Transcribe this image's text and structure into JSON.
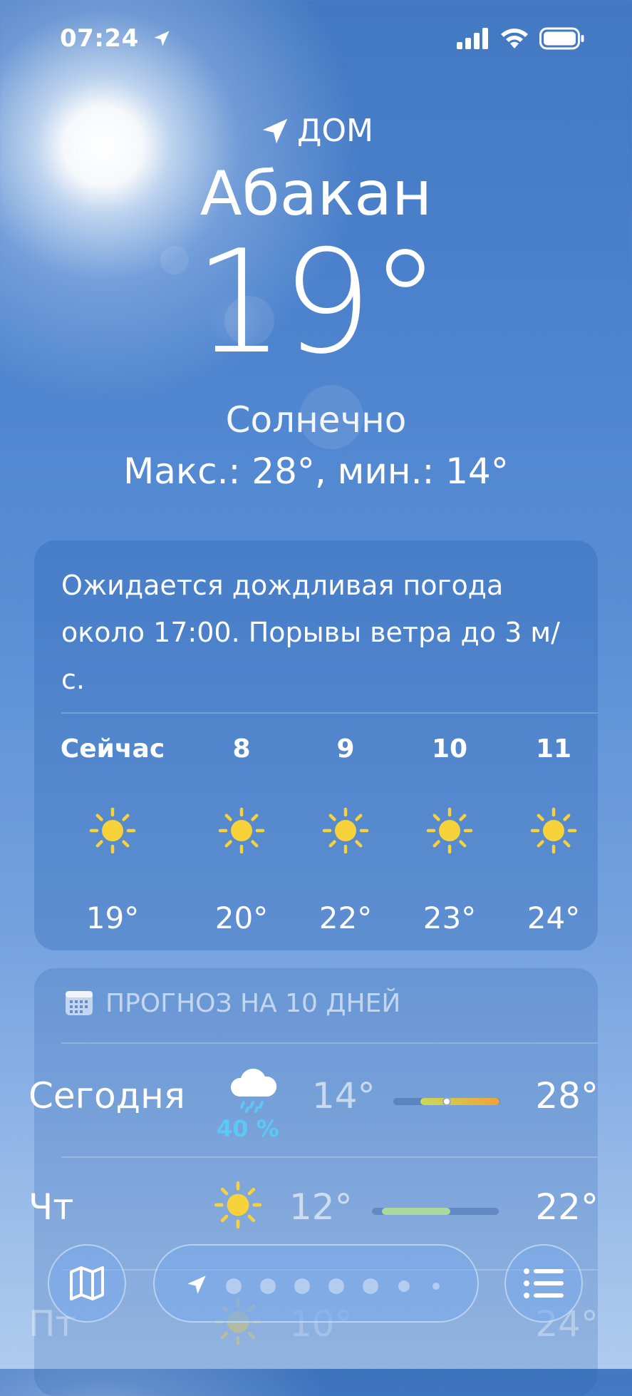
{
  "status_bar": {
    "time": "07:24",
    "icons": [
      "location-arrow-icon",
      "cellular-signal-icon",
      "wifi-icon",
      "battery-icon"
    ]
  },
  "location": {
    "label": "ДОМ",
    "city": "Абакан",
    "temperature": "19°",
    "condition": "Солнечно",
    "high_low": "Макс.: 28°, мин.: 14°"
  },
  "hourly": {
    "summary": "Ожидается дождливая погода около 17:00. Порывы ветра до 3 м/с.",
    "hours": [
      {
        "label": "Сейчас",
        "icon": "sun-icon",
        "temp": "19°"
      },
      {
        "label": "8",
        "icon": "sun-icon",
        "temp": "20°"
      },
      {
        "label": "9",
        "icon": "sun-icon",
        "temp": "22°"
      },
      {
        "label": "10",
        "icon": "sun-icon",
        "temp": "23°"
      },
      {
        "label": "11",
        "icon": "sun-icon",
        "temp": "24°"
      }
    ]
  },
  "forecast": {
    "title": "ПРОГНОЗ НА 10 ДНЕЙ",
    "days": [
      {
        "name": "Сегодня",
        "icon": "rain-cloud-icon",
        "precip": "40 %",
        "low": "14°",
        "high": "28°",
        "range_start": 0.25,
        "range_end": 0.99,
        "current": 0.5
      },
      {
        "name": "Чт",
        "icon": "sun-icon",
        "low": "12°",
        "high": "22°",
        "range_start": 0.08,
        "range_end": 0.62
      },
      {
        "name": "Пт",
        "icon": "sun-icon",
        "low": "10°",
        "high": "24°"
      }
    ]
  },
  "toolbar": {
    "map_button": "map-icon",
    "list_button": "list-icon",
    "page_indicator": {
      "current_location": "location-arrow-icon",
      "page_count": 7
    }
  },
  "colors": {
    "sun": "#f7d23a",
    "precip": "#5cc8f5",
    "bar_today_start": "#c9d95a",
    "bar_today_end": "#f0a33a",
    "bar_cool": "#a9d8a0"
  }
}
